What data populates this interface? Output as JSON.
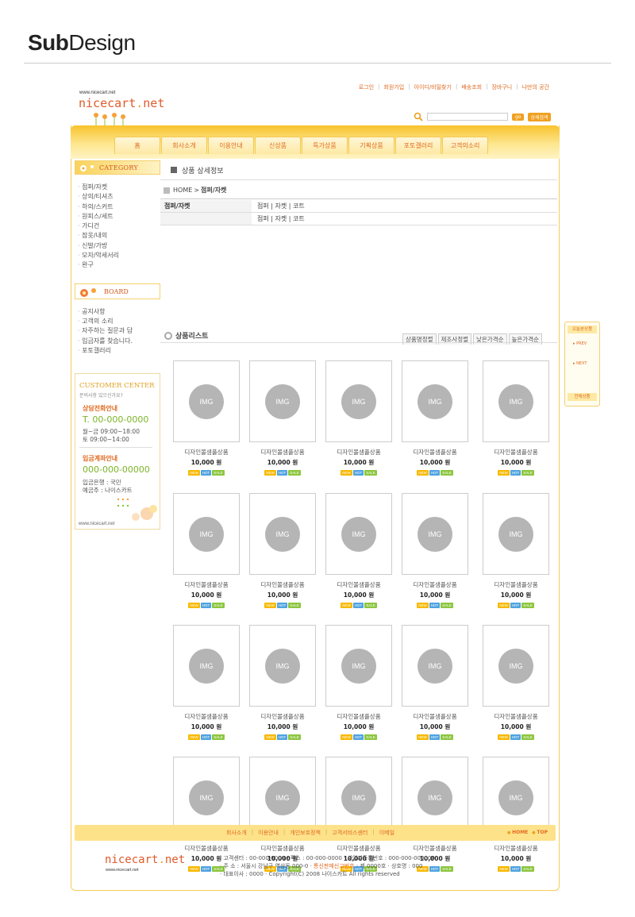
{
  "caption": {
    "bold": "Sub",
    "light": "Design"
  },
  "header": {
    "logo_url": "www.nicecart.net",
    "logo_main": "nicecart",
    "logo_dot": ".",
    "logo_tld": "net",
    "top_links": [
      "로그인",
      "회원가입",
      "아이디/비밀찾기",
      "배송조회",
      "장바구니",
      "나만의 공간"
    ],
    "go_label": "go",
    "detail_search_label": "상세검색"
  },
  "nav": {
    "tabs": [
      "홈",
      "회사소개",
      "이용안내",
      "신상품",
      "특가상품",
      "기획상품",
      "포토갤러리",
      "고객의소리"
    ]
  },
  "sidebar": {
    "category_title": "CATEGORY",
    "categories": [
      "점퍼/자켓",
      "상의/티셔츠",
      "하의/스커트",
      "원피스/세트",
      "가디건",
      "잠옷/내의",
      "신발/가방",
      "모자/악세서리",
      "완구"
    ],
    "board_title": "BOARD",
    "board_items": [
      "공지사항",
      "고객의 소리",
      "자주하는 질문과 답",
      "입금자를 찾습니다.",
      "포토갤러리"
    ],
    "cc": {
      "title": "CUSTOMER CENTER",
      "subtitle": "문의사항 있으신가요?",
      "phone_head": "상담전화안내",
      "phone": "T. 00-000-0000",
      "hours1": "월~금  09:00~18:00",
      "hours2": "토  09:00~14:00",
      "acct_head": "입금계좌안내",
      "acct": "000-000-00000",
      "bank1": "입금은행 : 국민",
      "bank2": "예금주 : 나이스카트",
      "url": "www.nicecart.net"
    }
  },
  "main": {
    "title": "상품 상세정보",
    "breadcrumb_home": "HOME",
    "breadcrumb_sep": ">",
    "breadcrumb_current": "점퍼/자켓",
    "cat_label": "점퍼/자켓",
    "cat_row1": "점퍼 | 자켓 | 코트",
    "cat_row2": "점퍼 | 자켓 | 코트",
    "list_title": "상품리스트",
    "sorts": [
      "상품명정렬",
      "제조사정렬",
      "낮은가격순",
      "높은가격순"
    ]
  },
  "products": {
    "img_label": "IMG",
    "name": "디자인몰샘플상품",
    "price": "10,000 원",
    "badges": [
      {
        "label": "NEW",
        "color": "#f7b900"
      },
      {
        "label": "HOT",
        "color": "#4fa3e0"
      },
      {
        "label": "SALE",
        "color": "#8cc63f"
      }
    ]
  },
  "recent": {
    "title": "오늘본상품",
    "prev": "▸ PREV",
    "next": "▸ NEXT",
    "all": "전체상품"
  },
  "footer": {
    "links": [
      "회사소개",
      "이용안내",
      "개인보호정책",
      "고객서비스센터",
      "이메일"
    ],
    "home": "HOME",
    "top": "TOP",
    "logo_main": "nicecart",
    "logo_dot": ".",
    "logo_tld": "net",
    "url": "www.nicecart.net",
    "info1": "· 고객센터 : 00-000-0000 / 팩스 : 00-000-0000 · 사업자등록번호 : 000-000-000000",
    "info2a": "· 주 소 : 서울시 강남구 역삼동 000-0 · ",
    "info2b": "통신판매신고번호",
    "info2c": " : 제 0000호 · 상호명 : 000",
    "info3": "· 대표이사 : 0000 · Copyright(C) 2008 나이스카트 All rights reserved"
  },
  "colors": {
    "accent": "#f0a020",
    "brand": "#e05a2a",
    "green": "#7bb427"
  }
}
